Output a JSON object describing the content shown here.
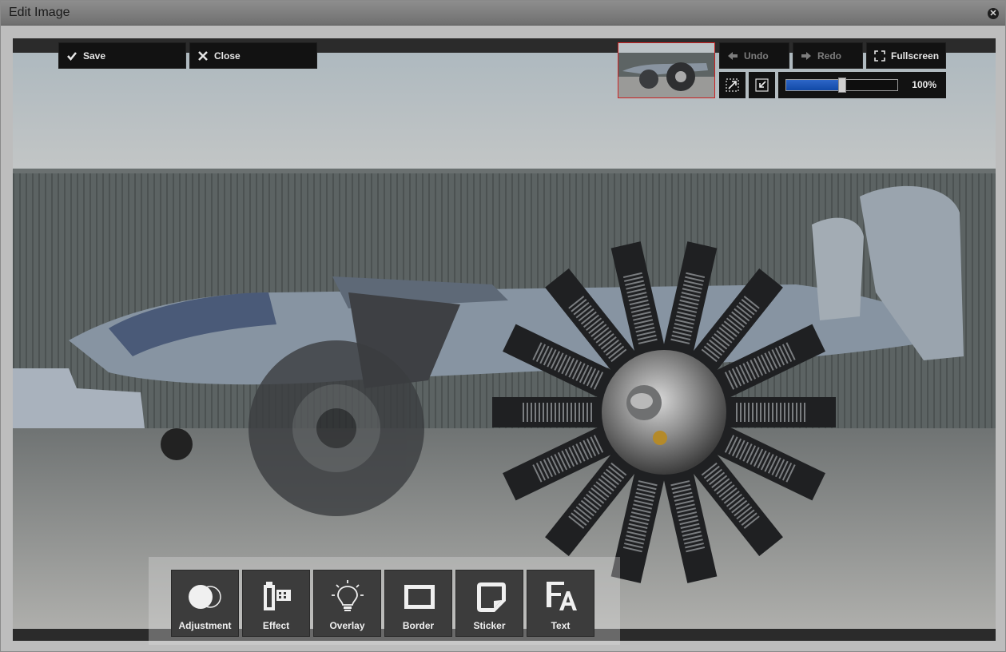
{
  "window": {
    "title": "Edit Image",
    "close_icon": "close-circle-icon"
  },
  "toolbar": {
    "save_label": "Save",
    "close_label": "Close",
    "undo_label": "Undo",
    "redo_label": "Redo",
    "fullscreen_label": "Fullscreen",
    "zoom_text": "100%",
    "zoom_fraction": 0.5
  },
  "tools": [
    {
      "label": "Adjustment",
      "icon": "adjustment-icon"
    },
    {
      "label": "Effect",
      "icon": "film-icon"
    },
    {
      "label": "Overlay",
      "icon": "lightbulb-icon"
    },
    {
      "label": "Border",
      "icon": "frame-icon"
    },
    {
      "label": "Sticker",
      "icon": "sticker-icon"
    },
    {
      "label": "Text",
      "icon": "text-icon"
    }
  ],
  "colors": {
    "accent": "#1f5bbf",
    "thumbnail_border": "#cc2222",
    "button_bg": "#121212"
  }
}
